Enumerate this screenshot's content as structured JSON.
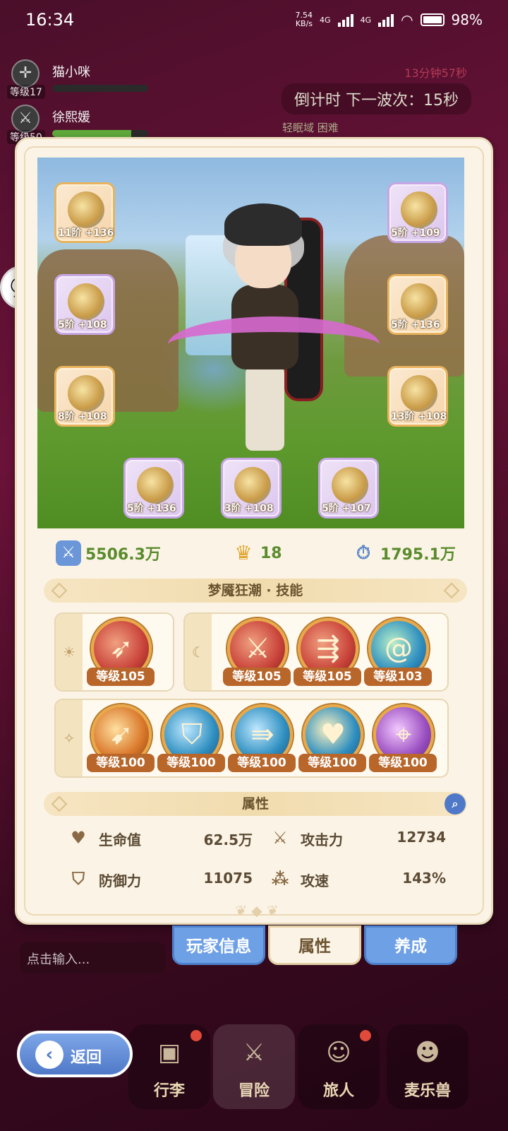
{
  "status_bar": {
    "time": "16:34",
    "net_speed_top": "7.54",
    "net_speed_unit": "KB/s",
    "net_type_1": "4G",
    "net_type_2": "4G",
    "battery": "98%"
  },
  "party": [
    {
      "name": "猫小咪",
      "level": "等级17",
      "icon": "crosshair-icon",
      "bar": 0.0
    },
    {
      "name": "徐熙媛",
      "level": "等级50",
      "icon": "sword-icon",
      "bar": 0.82
    }
  ],
  "timer": {
    "elapsed": "13分钟57秒",
    "next_wave": "倒计时 下一波次：15秒",
    "region": "轻眠域 困难"
  },
  "equipment": {
    "left": [
      {
        "name": "bow-equip",
        "level": "11阶",
        "bonus": "+136",
        "rarity": "gold"
      },
      {
        "name": "armor-equip",
        "level": "5阶",
        "bonus": "+108",
        "rarity": "purple"
      },
      {
        "name": "pants-equip",
        "level": "8阶",
        "bonus": "+108",
        "rarity": "gold"
      }
    ],
    "right": [
      {
        "name": "helmet-equip",
        "level": "5阶",
        "bonus": "+109",
        "rarity": "purple"
      },
      {
        "name": "gloves-equip",
        "level": "5阶",
        "bonus": "+136",
        "rarity": "gold"
      },
      {
        "name": "boots-equip",
        "level": "13阶",
        "bonus": "+108",
        "rarity": "gold"
      }
    ],
    "bottom": [
      {
        "name": "ring-equip",
        "level": "5阶",
        "bonus": "+136",
        "rarity": "purple"
      },
      {
        "name": "necklace-equip",
        "level": "3阶",
        "bonus": "+108",
        "rarity": "purple"
      },
      {
        "name": "charm-equip",
        "level": "5阶",
        "bonus": "+107",
        "rarity": "purple"
      }
    ]
  },
  "summary": {
    "power": "5506.3万",
    "crown": "18",
    "speed": "1795.1万"
  },
  "skills": {
    "header": "梦魇狂潮 · 技能",
    "sun_icon": "☀",
    "moon_icon": "☾",
    "star_icon": "✧",
    "sun": [
      {
        "name": "multi-arrow-skill",
        "level": "等级105",
        "color": "#c9433a"
      }
    ],
    "moon": [
      {
        "name": "sword-slash-skill",
        "level": "等级105",
        "color": "#c9433a"
      },
      {
        "name": "triple-arrow-skill",
        "level": "等级105",
        "color": "#c9433a"
      },
      {
        "name": "vortex-skill",
        "level": "等级103",
        "color": "#2f8fc0"
      }
    ],
    "passive": [
      {
        "name": "flying-arrow-skill",
        "level": "等级100",
        "color": "#d9772a"
      },
      {
        "name": "broken-shield-skill",
        "level": "等级100",
        "color": "#2f8fc0"
      },
      {
        "name": "arrow-rain-skill",
        "level": "等级100",
        "color": "#2f8fc0"
      },
      {
        "name": "heart-skill",
        "level": "等级100",
        "color": "#2f8fc0"
      },
      {
        "name": "target-skill",
        "level": "等级100",
        "color": "#9a4fc0"
      }
    ]
  },
  "attributes": {
    "header": "属性",
    "hp_label": "生命值",
    "hp_value": "62.5万",
    "atk_label": "攻击力",
    "atk_value": "12734",
    "def_label": "防御力",
    "def_value": "11075",
    "spd_label": "攻速",
    "spd_value": "143%"
  },
  "tabs": {
    "player_info": "玩家信息",
    "attributes": "属性",
    "cultivate": "养成"
  },
  "chat": {
    "placeholder": "点击输入..."
  },
  "nav": {
    "back": "返回",
    "luggage": "行李",
    "adventure": "冒险",
    "traveler": "旅人",
    "pet": "麦乐兽"
  }
}
